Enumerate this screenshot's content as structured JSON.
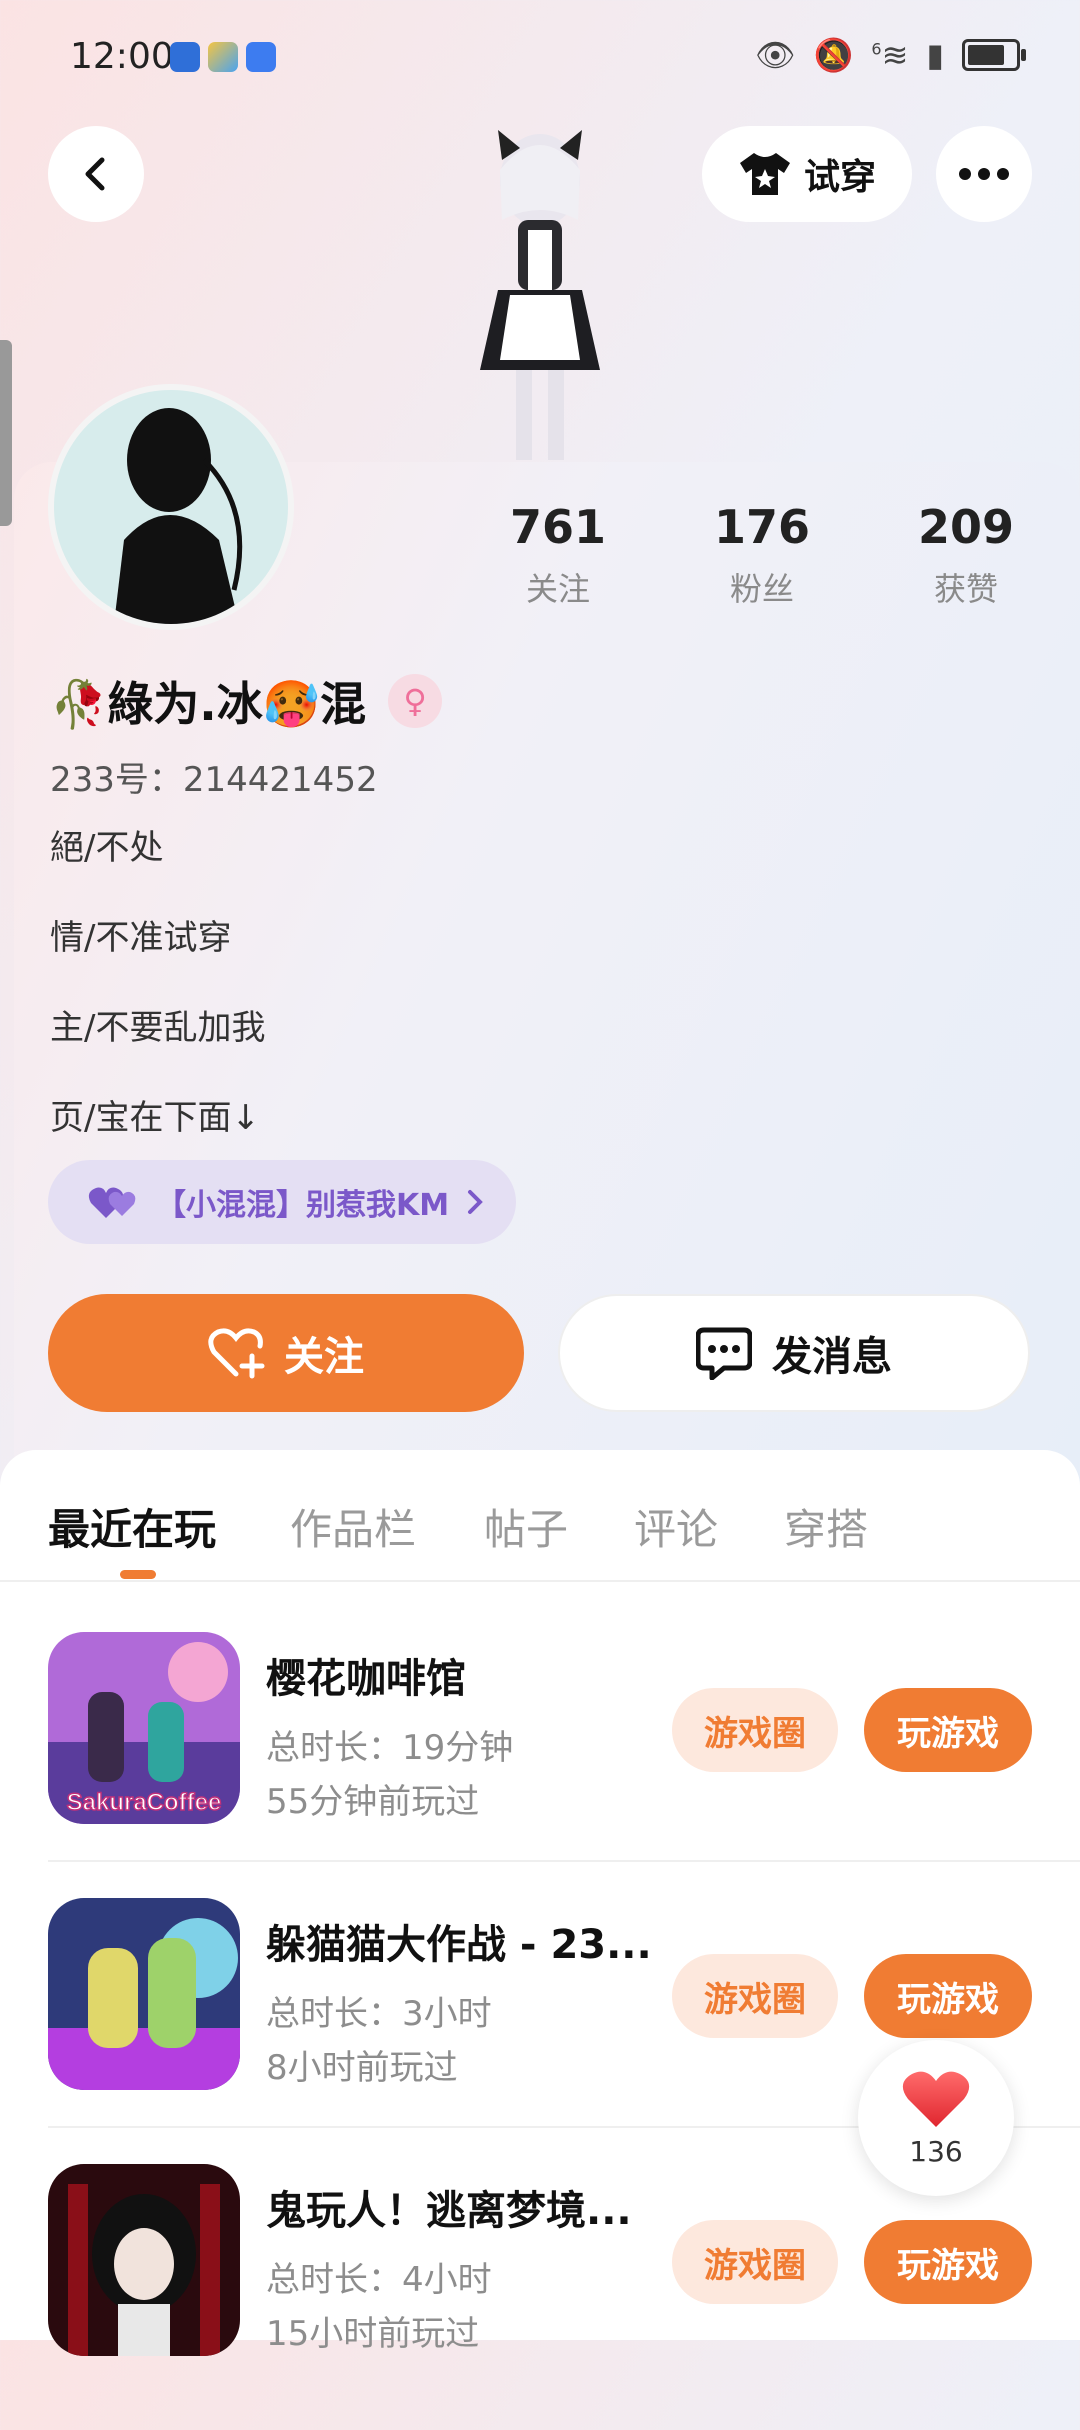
{
  "status_bar": {
    "time": "12:00",
    "signal": "6",
    "battery": 0.9
  },
  "header": {
    "try_on_label": "试穿"
  },
  "stats": [
    {
      "value": "761",
      "label": "关注"
    },
    {
      "value": "176",
      "label": "粉丝"
    },
    {
      "value": "209",
      "label": "获赞"
    }
  ],
  "profile": {
    "name": "🥀綠为.冰🥵混",
    "gender_symbol": "♀",
    "uid": "233号：214421452",
    "bio": [
      "絕/不处",
      "情/不准试穿",
      "主/不要乱加我",
      "页/宝在下面↓"
    ],
    "club": "【小混混】别惹我KM"
  },
  "actions": {
    "follow": "关注",
    "message": "发消息"
  },
  "tabs": [
    "最近在玩",
    "作品栏",
    "帖子",
    "评论",
    "穿搭"
  ],
  "games": [
    {
      "title": "樱花咖啡馆",
      "duration": "总时长：19分钟",
      "last_played": "55分钟前玩过",
      "thumb_text": "SakuraCoffee",
      "circle_label": "游戏圈",
      "play_label": "玩游戏"
    },
    {
      "title": "躲猫猫大作战 - 23...",
      "duration": "总时长：3小时",
      "last_played": "8小时前玩过",
      "thumb_text": "",
      "circle_label": "游戏圈",
      "play_label": "玩游戏"
    },
    {
      "title": "鬼玩人！逃离梦境...",
      "duration": "总时长：4小时",
      "last_played": "15小时前玩过",
      "thumb_text": "",
      "circle_label": "游戏圈",
      "play_label": "玩游戏"
    }
  ],
  "like_count": "136",
  "colors": {
    "accent": "#f07c33",
    "club": "#7b58c9",
    "gender": "#ef6f9a"
  }
}
